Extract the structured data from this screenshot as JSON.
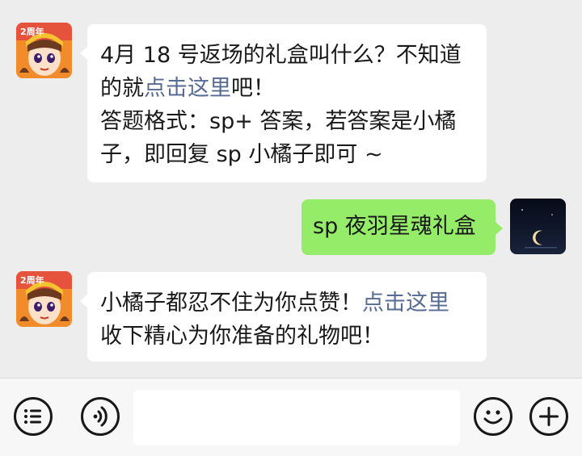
{
  "messages": [
    {
      "sender": "official",
      "lines": [
        {
          "text": "4月 18 号返场的礼盒叫什么？不知道"
        },
        {
          "prefix": "的就",
          "link": "点击这里",
          "suffix": "吧！"
        },
        {
          "text": "答题格式：sp+ 答案，若答案是小橘"
        },
        {
          "text": "子，即回复 sp 小橘子即可 ~"
        }
      ]
    },
    {
      "sender": "me",
      "text": "sp 夜羽星魂礼盒"
    },
    {
      "sender": "official",
      "lines": [
        {
          "prefix": "小橘子都忍不住为你点赞！",
          "link": "点击这里"
        },
        {
          "text": "收下精心为你准备的礼物吧！"
        }
      ]
    }
  ],
  "avatar_badge": "2周年",
  "colors": {
    "background": "#ededed",
    "bubble_in": "#ffffff",
    "bubble_out": "#95ec69",
    "link": "#576b95"
  },
  "input_bar": {
    "icons": [
      "menu-list-icon",
      "voice-icon",
      "emoji-icon",
      "add-icon"
    ],
    "input_value": ""
  }
}
